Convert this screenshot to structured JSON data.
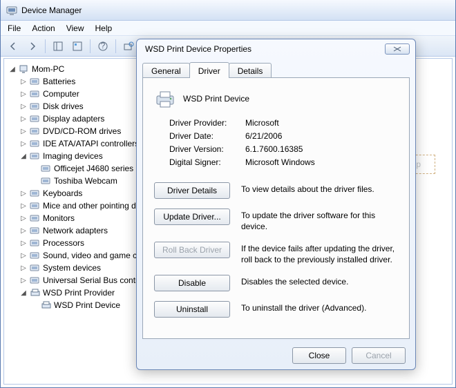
{
  "window": {
    "title": "Device Manager"
  },
  "menus": {
    "file": "File",
    "action": "Action",
    "view": "View",
    "help": "Help"
  },
  "tree": {
    "root": "Mom-PC",
    "nodes": [
      {
        "label": "Batteries"
      },
      {
        "label": "Computer"
      },
      {
        "label": "Disk drives"
      },
      {
        "label": "Display adapters"
      },
      {
        "label": "DVD/CD-ROM drives"
      },
      {
        "label": "IDE ATA/ATAPI controllers"
      },
      {
        "label": "Imaging devices",
        "expanded": true,
        "children": [
          {
            "label": "Officejet J4680 series"
          },
          {
            "label": "Toshiba Webcam"
          }
        ]
      },
      {
        "label": "Keyboards"
      },
      {
        "label": "Mice and other pointing devices"
      },
      {
        "label": "Monitors"
      },
      {
        "label": "Network adapters"
      },
      {
        "label": "Processors"
      },
      {
        "label": "Sound, video and game controllers"
      },
      {
        "label": "System devices"
      },
      {
        "label": "Universal Serial Bus controllers"
      },
      {
        "label": "WSD Print Provider",
        "expanded": true,
        "children": [
          {
            "label": "WSD Print Device"
          }
        ]
      }
    ]
  },
  "dialog": {
    "title": "WSD Print Device Properties",
    "tabs": {
      "general": "General",
      "driver": "Driver",
      "details": "Details",
      "active": "driver"
    },
    "device_name": "WSD Print Device",
    "fields": {
      "provider_k": "Driver Provider:",
      "provider_v": "Microsoft",
      "date_k": "Driver Date:",
      "date_v": "6/21/2006",
      "version_k": "Driver Version:",
      "version_v": "6.1.7600.16385",
      "signer_k": "Digital Signer:",
      "signer_v": "Microsoft Windows"
    },
    "actions": {
      "details": {
        "label": "Driver Details",
        "desc": "To view details about the driver files."
      },
      "update": {
        "label": "Update Driver...",
        "desc": "To update the driver software for this device."
      },
      "rollback": {
        "label": "Roll Back Driver",
        "desc": "If the device fails after updating the driver, roll back to the previously installed driver."
      },
      "disable": {
        "label": "Disable",
        "desc": "Disables the selected device."
      },
      "uninstall": {
        "label": "Uninstall",
        "desc": "To uninstall the driver (Advanced)."
      }
    },
    "footer": {
      "close": "Close",
      "cancel": "Cancel"
    }
  },
  "snip": {
    "label": "Rectangular Snip"
  }
}
